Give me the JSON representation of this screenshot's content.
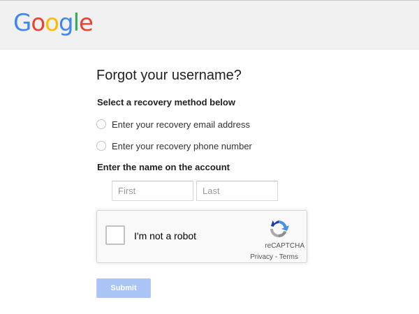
{
  "header": {
    "logo_letters": [
      {
        "char": "G",
        "color": "#4285F4"
      },
      {
        "char": "o",
        "color": "#EA4335"
      },
      {
        "char": "o",
        "color": "#FBBC05"
      },
      {
        "char": "g",
        "color": "#4285F4"
      },
      {
        "char": "l",
        "color": "#34A853"
      },
      {
        "char": "e",
        "color": "#EA4335"
      }
    ]
  },
  "main": {
    "title": "Forgot your username?",
    "recovery_heading": "Select a recovery method below",
    "options": [
      {
        "label": "Enter your recovery email address",
        "selected": false
      },
      {
        "label": "Enter your recovery phone number",
        "selected": false
      }
    ],
    "name_heading": "Enter the name on the account",
    "first": {
      "placeholder": "First",
      "value": ""
    },
    "last": {
      "placeholder": "Last",
      "value": ""
    }
  },
  "captcha": {
    "label": "I'm not a robot",
    "brand": "reCAPTCHA",
    "privacy": "Privacy",
    "separator": " - ",
    "terms": "Terms",
    "icon": "recaptcha-icon"
  },
  "submit": {
    "label": "Submit",
    "enabled": false
  },
  "colors": {
    "accent_disabled": "#a9c4f5",
    "topbar_bg": "#f1f1f1"
  }
}
